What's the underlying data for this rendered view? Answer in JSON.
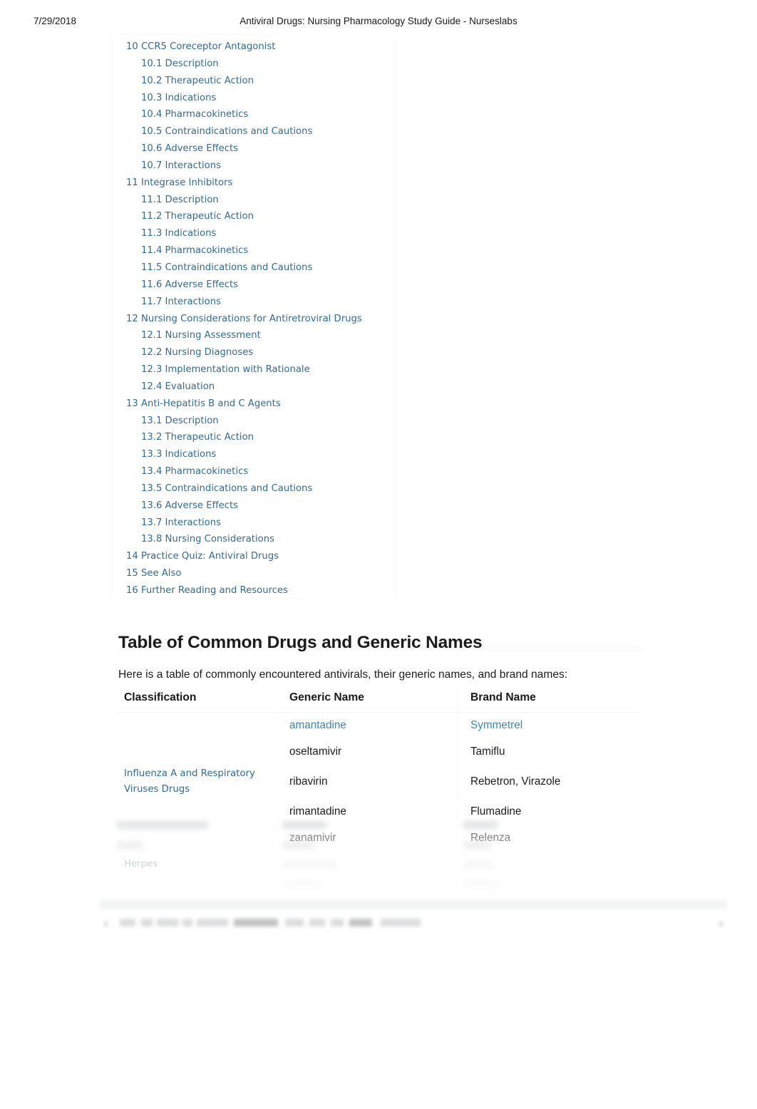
{
  "print_header": {
    "date": "7/29/2018",
    "title": "Antiviral Drugs: Nursing Pharmacology Study Guide - Nurseslabs"
  },
  "toc": {
    "items": [
      {
        "label": "10 CCR5 Coreceptor Antagonist",
        "level": 1
      },
      {
        "label": "10.1 Description",
        "level": 2
      },
      {
        "label": "10.2 Therapeutic Action",
        "level": 2
      },
      {
        "label": "10.3 Indications",
        "level": 2
      },
      {
        "label": "10.4 Pharmacokinetics",
        "level": 2
      },
      {
        "label": "10.5 Contraindications and Cautions",
        "level": 2
      },
      {
        "label": "10.6 Adverse Effects",
        "level": 2
      },
      {
        "label": "10.7 Interactions",
        "level": 2
      },
      {
        "label": "11 Integrase Inhibitors",
        "level": 1
      },
      {
        "label": "11.1 Description",
        "level": 2
      },
      {
        "label": "11.2 Therapeutic Action",
        "level": 2
      },
      {
        "label": "11.3 Indications",
        "level": 2
      },
      {
        "label": "11.4 Pharmacokinetics",
        "level": 2
      },
      {
        "label": "11.5 Contraindications and Cautions",
        "level": 2
      },
      {
        "label": "11.6 Adverse Effects",
        "level": 2
      },
      {
        "label": "11.7 Interactions",
        "level": 2
      },
      {
        "label": "12 Nursing Considerations for Antiretroviral Drugs",
        "level": 1
      },
      {
        "label": "12.1 Nursing Assessment",
        "level": 2
      },
      {
        "label": "12.2 Nursing Diagnoses",
        "level": 2
      },
      {
        "label": "12.3 Implementation with Rationale",
        "level": 2
      },
      {
        "label": "12.4 Evaluation",
        "level": 2
      },
      {
        "label": "13 Anti-Hepatitis B and C Agents",
        "level": 1
      },
      {
        "label": "13.1 Description",
        "level": 2
      },
      {
        "label": "13.2 Therapeutic Action",
        "level": 2
      },
      {
        "label": "13.3 Indications",
        "level": 2
      },
      {
        "label": "13.4 Pharmacokinetics",
        "level": 2
      },
      {
        "label": "13.5 Contraindications and Cautions",
        "level": 2
      },
      {
        "label": "13.6 Adverse Effects",
        "level": 2
      },
      {
        "label": "13.7 Interactions",
        "level": 2
      },
      {
        "label": "13.8 Nursing Considerations",
        "level": 2
      },
      {
        "label": "14 Practice Quiz: Antiviral Drugs",
        "level": 1
      },
      {
        "label": "15 See Also",
        "level": 1
      },
      {
        "label": "16 Further Reading and Resources",
        "level": 1
      }
    ]
  },
  "section": {
    "heading": "Table of Common Drugs and Generic Names",
    "intro": "Here is a table of commonly encountered antivirals, their generic names, and brand names:"
  },
  "table": {
    "headers": [
      "Classification",
      "Generic Name",
      "Brand Name"
    ],
    "groups": [
      {
        "classification": "Influenza A and Respiratory Viruses Drugs",
        "classification_is_link": true,
        "rows": [
          {
            "generic": "amantadine",
            "generic_is_link": true,
            "brand": "Symmetrel",
            "brand_is_link": true
          },
          {
            "generic": "oseltamivir",
            "generic_is_link": false,
            "brand": "Tamiflu",
            "brand_is_link": false
          },
          {
            "generic": "ribavirin",
            "generic_is_link": false,
            "brand": "Rebetron, Virazole",
            "brand_is_link": false
          },
          {
            "generic": "rimantadine",
            "generic_is_link": false,
            "brand": "Flumadine",
            "brand_is_link": false
          },
          {
            "generic": "zanamivir",
            "generic_is_link": false,
            "brand": "Relenza",
            "brand_is_link": false
          }
        ]
      },
      {
        "classification": "Herpes",
        "classification_is_link": true,
        "rows": []
      }
    ]
  },
  "colors": {
    "toc_link": "#336c92",
    "table_link": "#3d86b0",
    "body_text": "#1c1c1c",
    "page_background": "#ffffff"
  }
}
